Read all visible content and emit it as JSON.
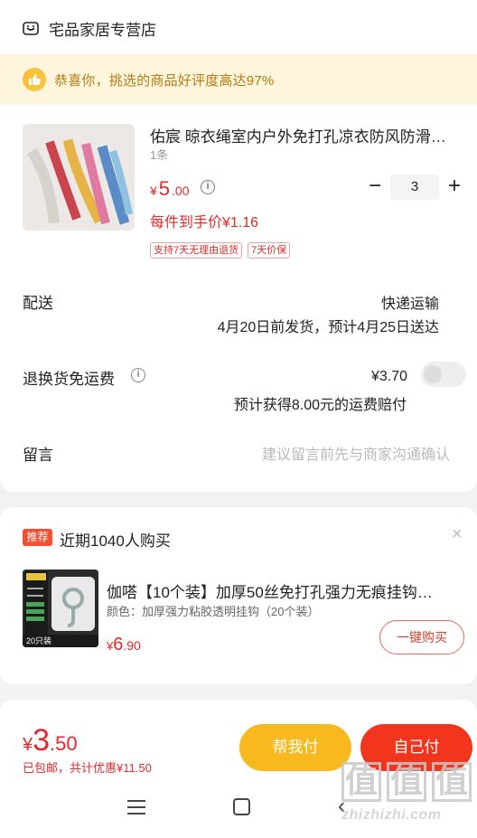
{
  "shop": {
    "name": "宅品家居专营店",
    "icon": "shop-icon"
  },
  "banner": {
    "text": "恭喜你，挑选的商品好评度高达97%",
    "icon": "thumbs-up-icon",
    "accent": "#b87a10"
  },
  "product": {
    "title": "佑宸 晾衣绳室内户外免打孔凉衣防风防滑…",
    "spec": "1条",
    "price_currency": "¥",
    "price_int": "5",
    "price_dec": ".00",
    "quantity": "3",
    "per_item_text": "每件到手价¥1.16",
    "tags": [
      "支持7天无理由退货",
      "7天价保"
    ]
  },
  "delivery": {
    "label": "配送",
    "method": "快递运输",
    "note": "4月20日前发货，预计4月25日送达"
  },
  "return_insurance": {
    "label": "退换货免运费",
    "price": "¥3.70",
    "note": "预计获得8.00元的运费赔付",
    "enabled": false
  },
  "message": {
    "label": "留言",
    "placeholder": "建议留言前先与商家沟通确认"
  },
  "recommend": {
    "badge": "推荐",
    "title": "近期1040人购买",
    "item": {
      "name": "伽嗒【10个装】加厚50丝免打孔强力无痕挂钩…",
      "spec": "颜色：加厚强力粘胶透明挂钩（20个装）",
      "price_currency": "¥",
      "price_int": "6",
      "price_dec": ".90",
      "buy_label": "一键购买",
      "thumb_lines": [
        "伍嘉装",
        "加厚粘胶",
        "无痕贴片",
        "20只装"
      ]
    }
  },
  "bottom": {
    "total_currency": "¥",
    "total_int": "3",
    "total_dec": ".50",
    "total_sub": "已包邮，共计优惠¥11.50",
    "help_label": "帮我付",
    "self_label": "自己付"
  },
  "watermark": {
    "chars": [
      "值",
      "值",
      "值"
    ],
    "url": "zhizhizhi.com"
  },
  "colors": {
    "price_red": "#e22a2a",
    "btn_yellow": "#f7b91d",
    "btn_red": "#f2361e"
  }
}
